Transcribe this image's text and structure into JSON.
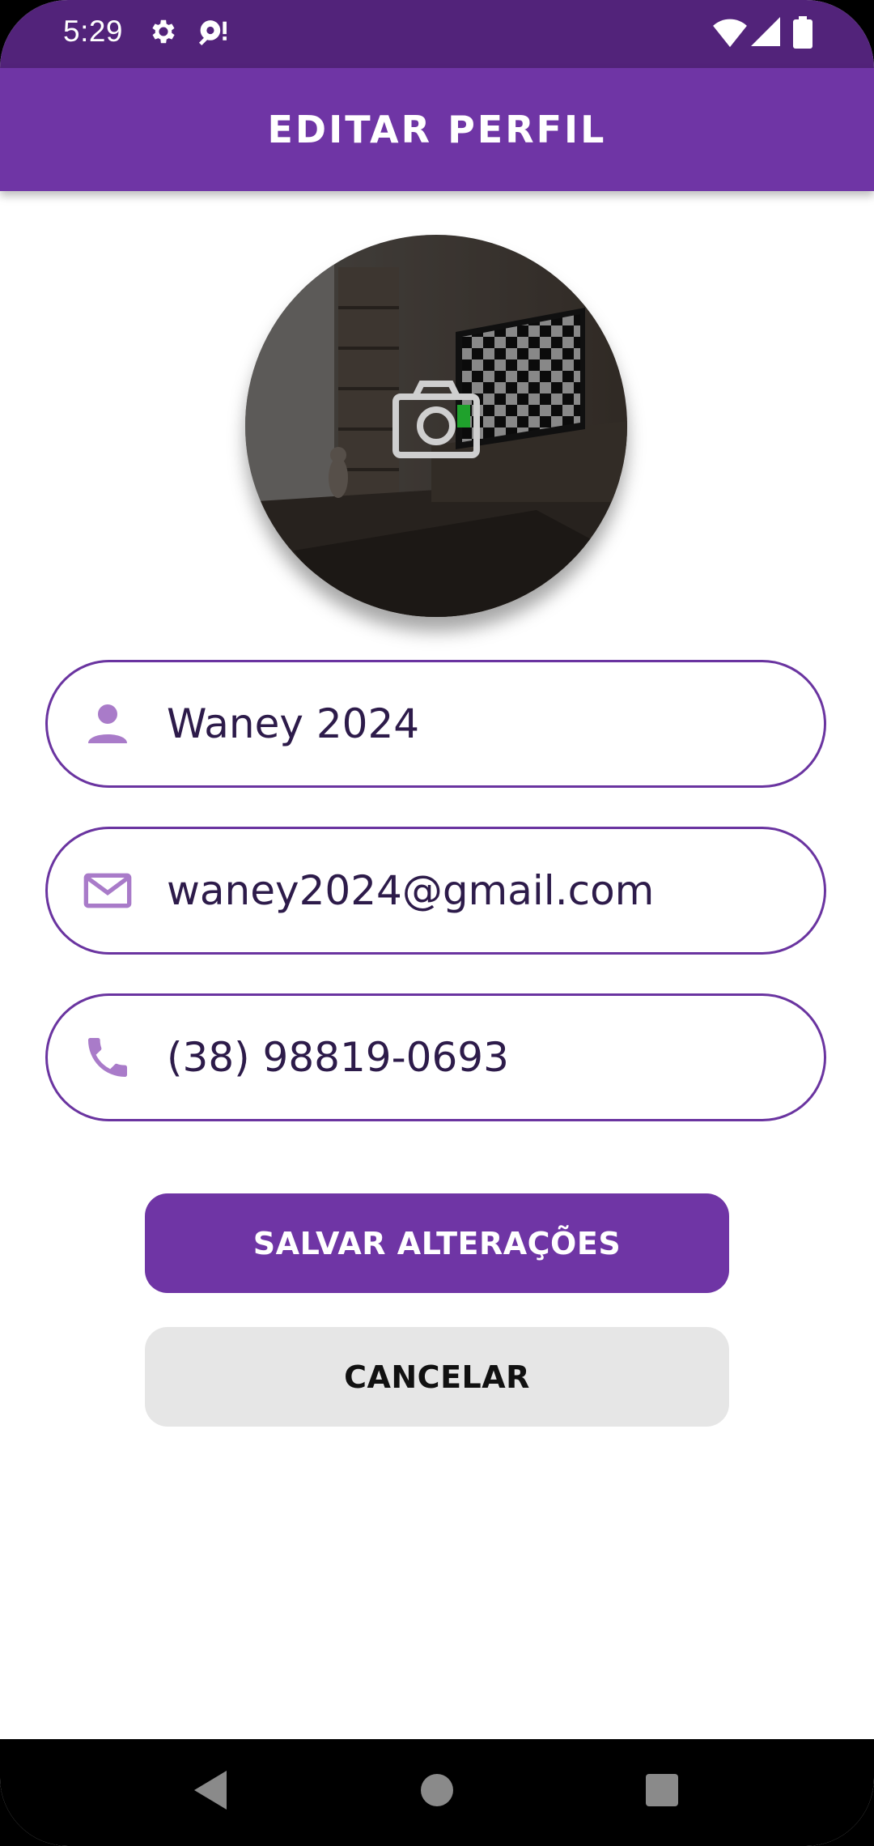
{
  "status_bar": {
    "time": "5:29",
    "icons": [
      "settings-icon",
      "notification-icon",
      "wifi-icon",
      "signal-icon",
      "battery-icon"
    ]
  },
  "app_bar": {
    "title": "EDITAR PERFIL"
  },
  "avatar": {
    "overlay_icon": "camera-icon"
  },
  "fields": {
    "name": {
      "icon": "person-icon",
      "value": "Waney 2024"
    },
    "email": {
      "icon": "mail-icon",
      "value": "waney2024@gmail.com"
    },
    "phone": {
      "icon": "phone-icon",
      "value": "(38) 98819-0693"
    }
  },
  "buttons": {
    "save_label": "SALVAR ALTERAÇÕES",
    "cancel_label": "CANCELAR"
  },
  "colors": {
    "status_bar": "#52237a",
    "primary": "#6f35a5",
    "field_border": "#6a34a0",
    "field_icon": "#a97bc9",
    "cancel_bg": "#e6e6e6"
  }
}
